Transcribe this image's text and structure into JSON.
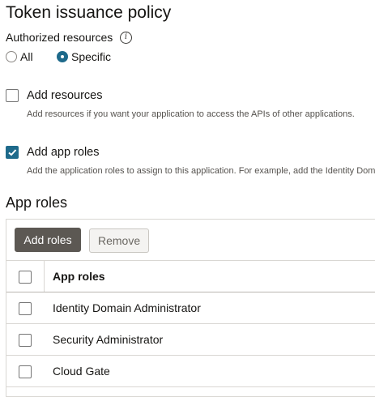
{
  "page": {
    "title": "Token issuance policy"
  },
  "authorized_resources": {
    "label": "Authorized resources",
    "info_icon": "info-icon",
    "options": [
      {
        "label": "All",
        "selected": false
      },
      {
        "label": "Specific",
        "selected": true
      }
    ]
  },
  "add_resources": {
    "label": "Add resources",
    "checked": false,
    "description": "Add resources if you want your application to access the APIs of other applications."
  },
  "add_app_roles": {
    "label": "Add app roles",
    "checked": true,
    "description": "Add the application roles to assign to this application. For example, add the Identity Doma"
  },
  "app_roles_section": {
    "title": "App roles",
    "add_button": "Add roles",
    "remove_button": "Remove",
    "column_header": "App roles",
    "rows": [
      {
        "name": "Identity Domain Administrator"
      },
      {
        "name": "Security Administrator"
      },
      {
        "name": "Cloud Gate"
      }
    ]
  },
  "colors": {
    "accent": "#1e6a8b",
    "primary_button": "#5c5853"
  }
}
